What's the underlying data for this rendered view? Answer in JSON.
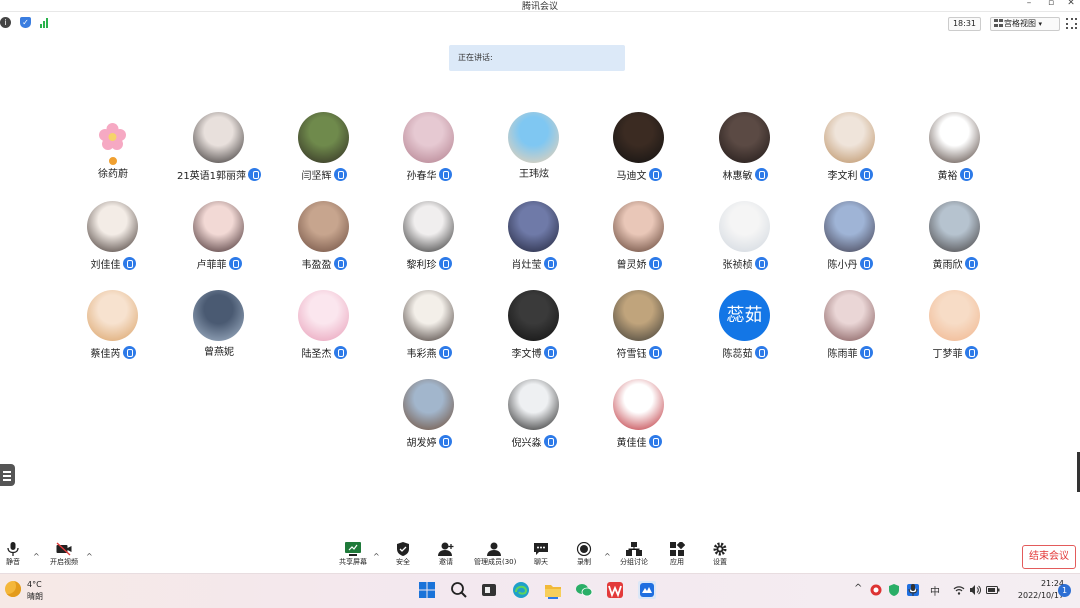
{
  "window": {
    "title": "腾讯会议"
  },
  "header": {
    "time": "18:31",
    "view_mode": "宫格视图",
    "view_caret": "▾"
  },
  "speaking": {
    "label": "正在讲话:"
  },
  "participants": [
    {
      "name": "徐药蔚",
      "mic": false,
      "avatar": "flower-avatar",
      "colors": [
        "#fbe3ea",
        "#f6a9c3"
      ]
    },
    {
      "name": "21英语1郭丽萍",
      "mic": true,
      "avatar": "photo-avatar",
      "colors": [
        "#e8e0dc",
        "#2e2a2a"
      ]
    },
    {
      "name": "闫坚辉",
      "mic": true,
      "avatar": "photo-avatar",
      "colors": [
        "#6f8a4c",
        "#2f2a22"
      ]
    },
    {
      "name": "孙春华",
      "mic": true,
      "avatar": "photo-avatar",
      "colors": [
        "#e6c9d2",
        "#b07c8b"
      ]
    },
    {
      "name": "王玮炫",
      "mic": false,
      "avatar": "cartoon-avatar",
      "colors": [
        "#7fc7f2",
        "#f3d3b0"
      ]
    },
    {
      "name": "马迪文",
      "mic": true,
      "avatar": "photo-avatar",
      "colors": [
        "#3b2b22",
        "#111111"
      ]
    },
    {
      "name": "林惠敏",
      "mic": true,
      "avatar": "photo-avatar",
      "colors": [
        "#5b4a44",
        "#1e1716"
      ]
    },
    {
      "name": "李文利",
      "mic": true,
      "avatar": "photo-avatar",
      "colors": [
        "#efe4da",
        "#b98d5f"
      ]
    },
    {
      "name": "黄裕",
      "mic": true,
      "avatar": "cartoon-avatar",
      "colors": [
        "#ffffff",
        "#4a3a33"
      ]
    },
    {
      "name": "刘佳佳",
      "mic": true,
      "avatar": "photo-avatar",
      "colors": [
        "#f3ece6",
        "#3a2e2a"
      ]
    },
    {
      "name": "卢菲菲",
      "mic": true,
      "avatar": "photo-avatar",
      "colors": [
        "#f2d9d5",
        "#3b2528"
      ]
    },
    {
      "name": "韦盈盈",
      "mic": true,
      "avatar": "photo-avatar",
      "colors": [
        "#c7a58e",
        "#6b4b3e"
      ]
    },
    {
      "name": "黎利珍",
      "mic": true,
      "avatar": "photo-avatar",
      "colors": [
        "#f0eeee",
        "#2b2b2b"
      ]
    },
    {
      "name": "肖灶莹",
      "mic": true,
      "avatar": "photo-avatar",
      "colors": [
        "#6f7aa8",
        "#1f2238"
      ]
    },
    {
      "name": "曾灵娇",
      "mic": true,
      "avatar": "photo-avatar",
      "colors": [
        "#e9c7b8",
        "#5a3b2e"
      ]
    },
    {
      "name": "张祯桢",
      "mic": true,
      "avatar": "cartoon-avatar",
      "colors": [
        "#f5f5f5",
        "#cfd6de"
      ]
    },
    {
      "name": "陈小丹",
      "mic": true,
      "avatar": "photo-avatar",
      "colors": [
        "#9fb4d6",
        "#3e3a4a"
      ]
    },
    {
      "name": "黄雨欣",
      "mic": true,
      "avatar": "photo-avatar",
      "colors": [
        "#b6c3cf",
        "#3f3a3a"
      ]
    },
    {
      "name": "蔡佳芮",
      "mic": true,
      "avatar": "photo-avatar",
      "colors": [
        "#f7e2cf",
        "#d9a064"
      ]
    },
    {
      "name": "曾燕妮",
      "mic": false,
      "avatar": "photo-avatar",
      "colors": [
        "#4a5a72",
        "#a7b8cc"
      ]
    },
    {
      "name": "陆圣杰",
      "mic": true,
      "avatar": "cartoon-avatar",
      "colors": [
        "#fbe6ee",
        "#e79cb6"
      ]
    },
    {
      "name": "韦彩燕",
      "mic": true,
      "avatar": "cartoon-avatar",
      "colors": [
        "#f3efe9",
        "#3a2f2c"
      ]
    },
    {
      "name": "李文博",
      "mic": true,
      "avatar": "photo-avatar",
      "colors": [
        "#3a3a3a",
        "#101010"
      ]
    },
    {
      "name": "符雪钰",
      "mic": true,
      "avatar": "photo-avatar",
      "colors": [
        "#c0a47c",
        "#3b3a35"
      ]
    },
    {
      "name": "陈蕊茹",
      "mic": true,
      "avatar": "text-avatar",
      "avatar_text": "蕊茹",
      "colors": [
        "#1376e6",
        "#1376e6"
      ]
    },
    {
      "name": "陈雨菲",
      "mic": true,
      "avatar": "photo-avatar",
      "colors": [
        "#ead6d6",
        "#7a4f50"
      ]
    },
    {
      "name": "丁梦菲",
      "mic": true,
      "avatar": "photo-avatar",
      "colors": [
        "#f7dcc6",
        "#f0b48c"
      ]
    },
    {
      "name": "胡发婷",
      "mic": true,
      "avatar": "cartoon-avatar",
      "colors": [
        "#a2b6cc",
        "#6e4b34"
      ]
    },
    {
      "name": "倪兴淼",
      "mic": true,
      "avatar": "photo-avatar",
      "colors": [
        "#eef0f2",
        "#1b1b1b"
      ]
    },
    {
      "name": "黄佳佳",
      "mic": true,
      "avatar": "cartoon-avatar",
      "colors": [
        "#ffffff",
        "#b8232c"
      ]
    }
  ],
  "toolbar": {
    "mute": "静音",
    "video": "开启视频",
    "share": "共享屏幕",
    "security": "安全",
    "invite": "邀请",
    "members": "管理成员(30)",
    "chat": "聊天",
    "record": "录制",
    "breakout": "分组讨论",
    "apps": "应用",
    "settings": "设置",
    "end_meeting": "结束会议"
  },
  "taskbar": {
    "temperature": "4°C",
    "weather": "晴朗",
    "ime": "中",
    "time": "21:24",
    "date": "2022/10/17",
    "notifications": "1"
  },
  "colors": {
    "accent": "#2d7ae8",
    "end_red": "#e33a3a",
    "speaking_bg": "#dce9f8"
  }
}
